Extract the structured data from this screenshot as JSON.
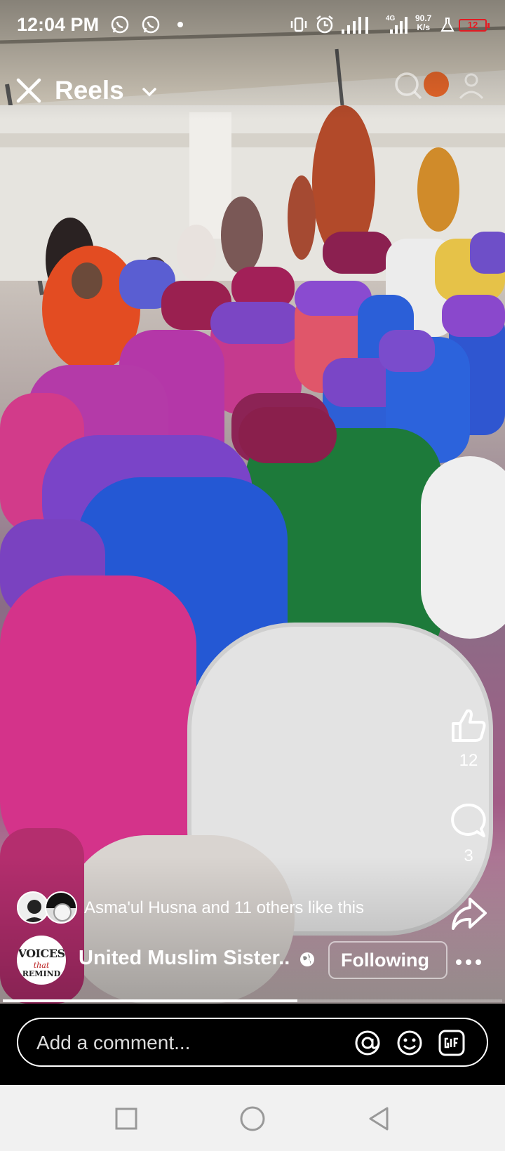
{
  "status_bar": {
    "time": "12:04 PM",
    "signal_label": "4G",
    "net_speed_value": "90.7",
    "net_speed_unit": "K/s",
    "battery": "12"
  },
  "header": {
    "title": "Reels"
  },
  "actions": {
    "likes": "12",
    "comments": "3"
  },
  "liked_by": {
    "text": "Asma'ul Husna and 11 others like this"
  },
  "page": {
    "name": "United Muslim Sister...",
    "avatar_text": "VOICES",
    "avatar_sub": "that",
    "avatar_bot": "REMIND",
    "follow_label": "Following"
  },
  "video_progress": 0.59,
  "comment": {
    "placeholder": "Add a comment..."
  },
  "colors": {
    "battery": "#e31b23"
  }
}
